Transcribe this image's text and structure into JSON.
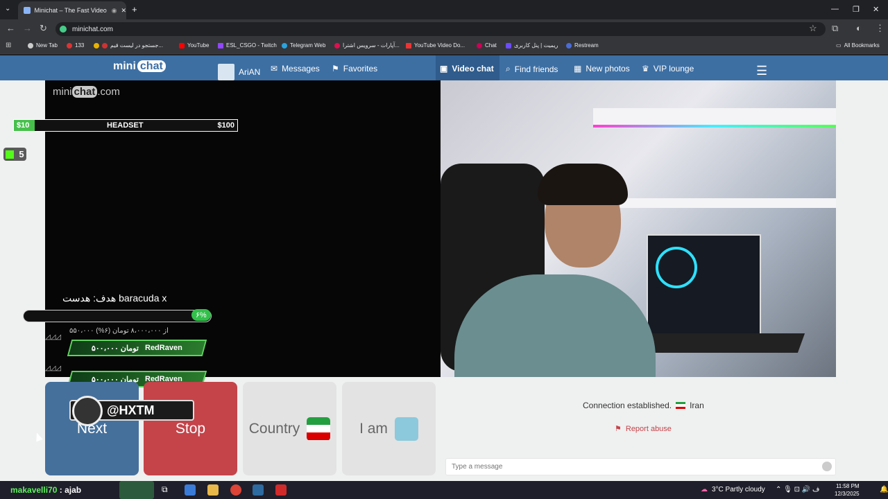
{
  "browser": {
    "tab_title": "Minichat – The Fast Video C",
    "url": "minichat.com",
    "window_controls": {
      "minimize": "—",
      "restore": "❐",
      "close": "✕"
    },
    "bookmarks": [
      {
        "label": "New Tab"
      },
      {
        "label": "133"
      },
      {
        "label": "جستجو در لیست قیم..."
      },
      {
        "label": "YouTube"
      },
      {
        "label": "ESL_CSGO - Twitch"
      },
      {
        "label": "Telegram Web"
      },
      {
        "label": "آپارات - سرویس اشترا..."
      },
      {
        "label": "YouTube Video Do..."
      },
      {
        "label": "Chat"
      },
      {
        "label": "ریمیت | پنل کاربری"
      },
      {
        "label": "Restream"
      }
    ],
    "all_bookmarks": "All Bookmarks"
  },
  "site": {
    "logo_text": "mini",
    "logo_bubble": "chat",
    "nav": {
      "user": "AriAN",
      "messages": "Messages",
      "favorites": "Favorites",
      "video_chat": "Video chat",
      "find_friends": "Find friends",
      "new_photos": "New photos",
      "vip_lounge": "VIP lounge"
    }
  },
  "stream_overlay": {
    "watermark_pre": "mini",
    "watermark_bubble": "chat",
    "watermark_post": ".com",
    "goal_min": "$10",
    "goal_item": "HEADSET",
    "goal_max": "$100",
    "kick_count": "5",
    "goal_text": "هدف: هدست baracuda x",
    "goal_percent": "۶%",
    "goal_percent_value": 0.06,
    "goal_amount": "۵۵۰،۰۰۰ از ۸،۰۰۰،۰۰۰ تومان (۶%)",
    "donations": [
      {
        "name": "RedRaven",
        "amount": "۵۰۰،۰۰۰ تومان"
      },
      {
        "name": "RedRaven",
        "amount": "۵۰۰،۰۰۰ تومان"
      }
    ],
    "hxtm": "@HXTM"
  },
  "controls": {
    "next": "Next",
    "stop": "Stop",
    "country": "Country",
    "i_am": "I am"
  },
  "chat_panel": {
    "connection": "Connection established.",
    "country": "Iran",
    "report": "Report abuse",
    "message_placeholder": "Type a message"
  },
  "taskbar": {
    "user": "makavelli70",
    "msg": ": ajab",
    "weather": "3°C  Partly cloudy",
    "time": "11:58 PM",
    "date": "12/3/2025"
  },
  "colors": {
    "header_blue": "#3d6fa3",
    "next_blue": "#45709c",
    "stop_red": "#c4444a",
    "kick_green": "#53fc18"
  }
}
